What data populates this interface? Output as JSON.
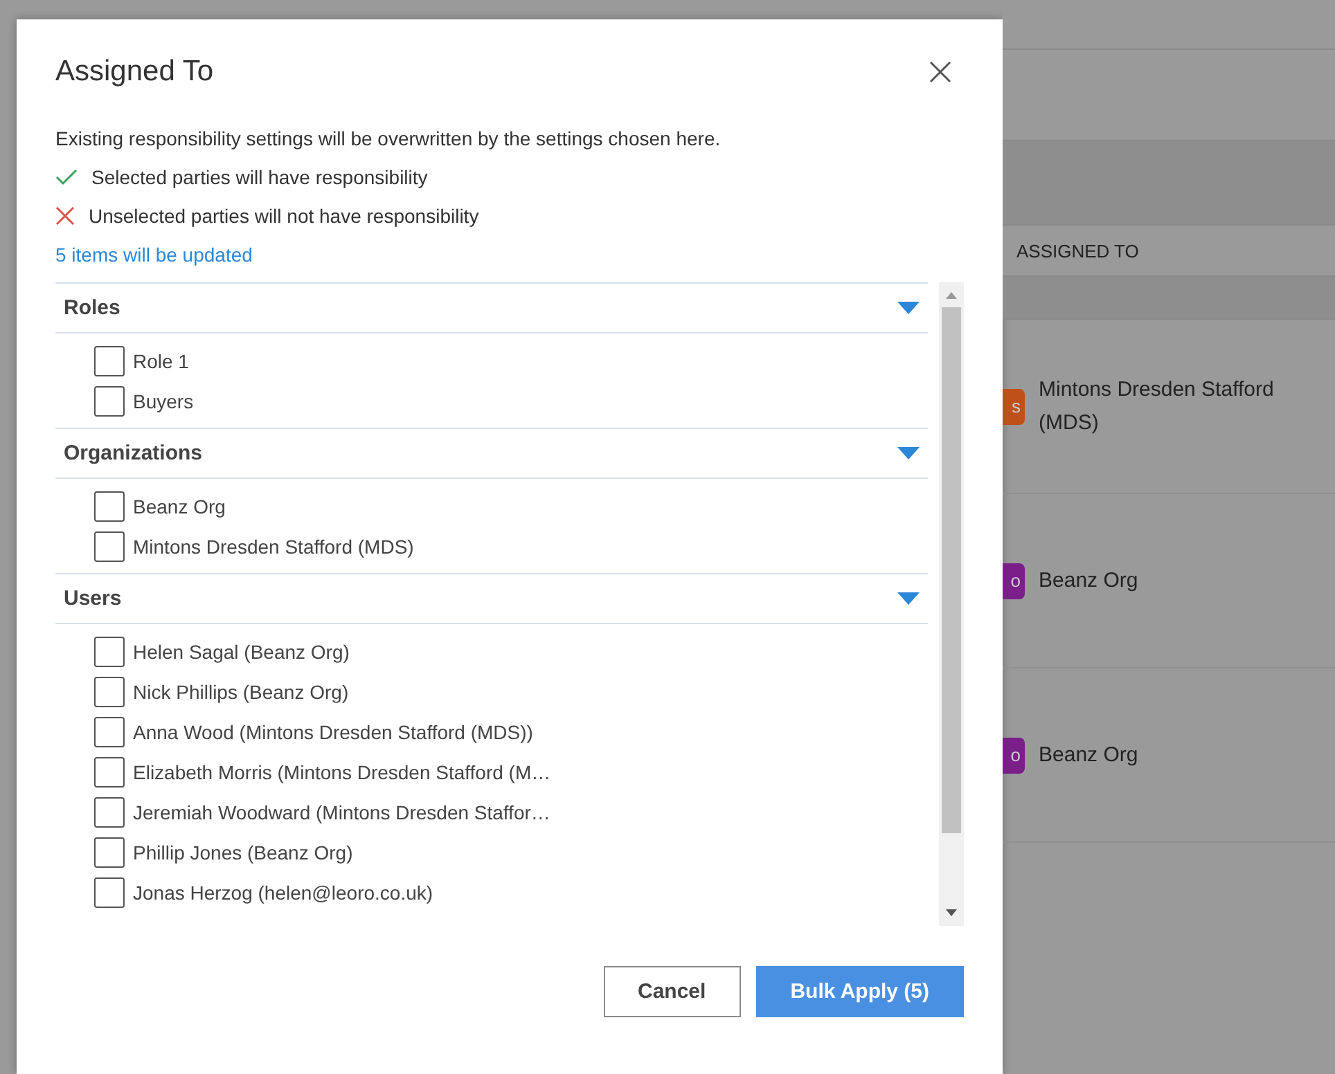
{
  "dialog": {
    "title": "Assigned To",
    "intro": "Existing responsibility settings will be overwritten by the settings chosen here.",
    "notes": [
      {
        "kind": "check",
        "text": "Selected parties will have responsibility"
      },
      {
        "kind": "cross",
        "text": "Unselected parties will not have responsibility"
      }
    ],
    "count_link": "5 items will be updated",
    "sections": [
      {
        "title": "Roles",
        "expanded": true,
        "items": [
          {
            "label": "Role 1",
            "checked": false
          },
          {
            "label": "Buyers",
            "checked": false
          }
        ]
      },
      {
        "title": "Organizations",
        "expanded": true,
        "items": [
          {
            "label": "Beanz Org",
            "checked": false
          },
          {
            "label": "Mintons Dresden Stafford (MDS)",
            "checked": false
          }
        ]
      },
      {
        "title": "Users",
        "expanded": true,
        "items": [
          {
            "label": "Helen Sagal (Beanz Org)",
            "checked": false
          },
          {
            "label": "Nick Phillips (Beanz Org)",
            "checked": false
          },
          {
            "label": "Anna Wood (Mintons Dresden Stafford (MDS))",
            "checked": false
          },
          {
            "label": "Elizabeth Morris (Mintons Dresden Stafford (M…",
            "checked": false
          },
          {
            "label": "Jeremiah Woodward (Mintons Dresden Staffor…",
            "checked": false
          },
          {
            "label": "Phillip Jones (Beanz Org)",
            "checked": false
          },
          {
            "label": "Jonas Herzog (helen@leoro.co.uk)",
            "checked": false
          }
        ]
      }
    ],
    "buttons": [
      {
        "kind": "secondary",
        "label": "Cancel"
      },
      {
        "kind": "primary",
        "label": "Bulk Apply (5)"
      }
    ]
  },
  "background": {
    "column_header": "ASSIGNED TO",
    "rows": [
      {
        "badge": "s",
        "color": "#c0501a",
        "text": "Mintons Dresden Stafford (MDS)"
      },
      {
        "badge": "o",
        "color": "#7a1f8a",
        "text": "Beanz Org"
      },
      {
        "badge": "o",
        "color": "#7a1f8a",
        "text": "Beanz Org"
      }
    ]
  }
}
